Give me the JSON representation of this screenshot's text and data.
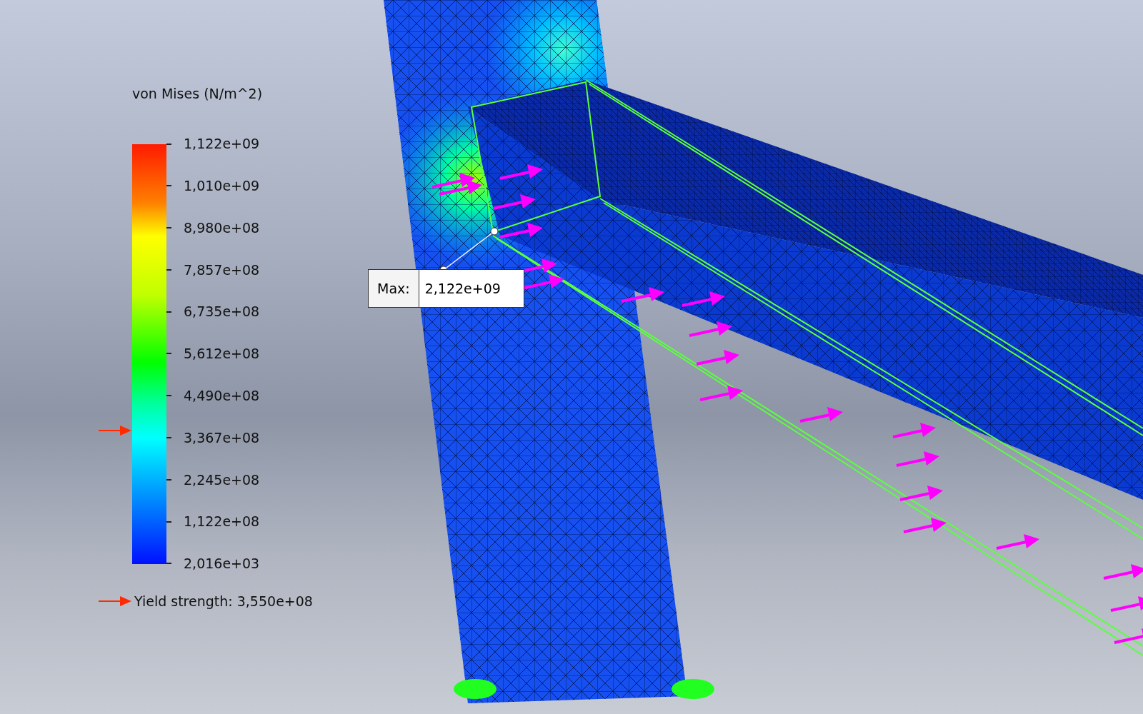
{
  "legend": {
    "title": "von Mises (N/m^2)",
    "ticks": [
      "1,122e+09",
      "1,010e+09",
      "8,980e+08",
      "7,857e+08",
      "6,735e+08",
      "5,612e+08",
      "4,490e+08",
      "3,367e+08",
      "2,245e+08",
      "1,122e+08",
      "2,016e+03"
    ],
    "yield_marker": {
      "level": 0.318
    },
    "yield_label": "Yield strength: 3,550e+08"
  },
  "max_callout": {
    "label": "Max:",
    "value": "2,122e+09"
  }
}
